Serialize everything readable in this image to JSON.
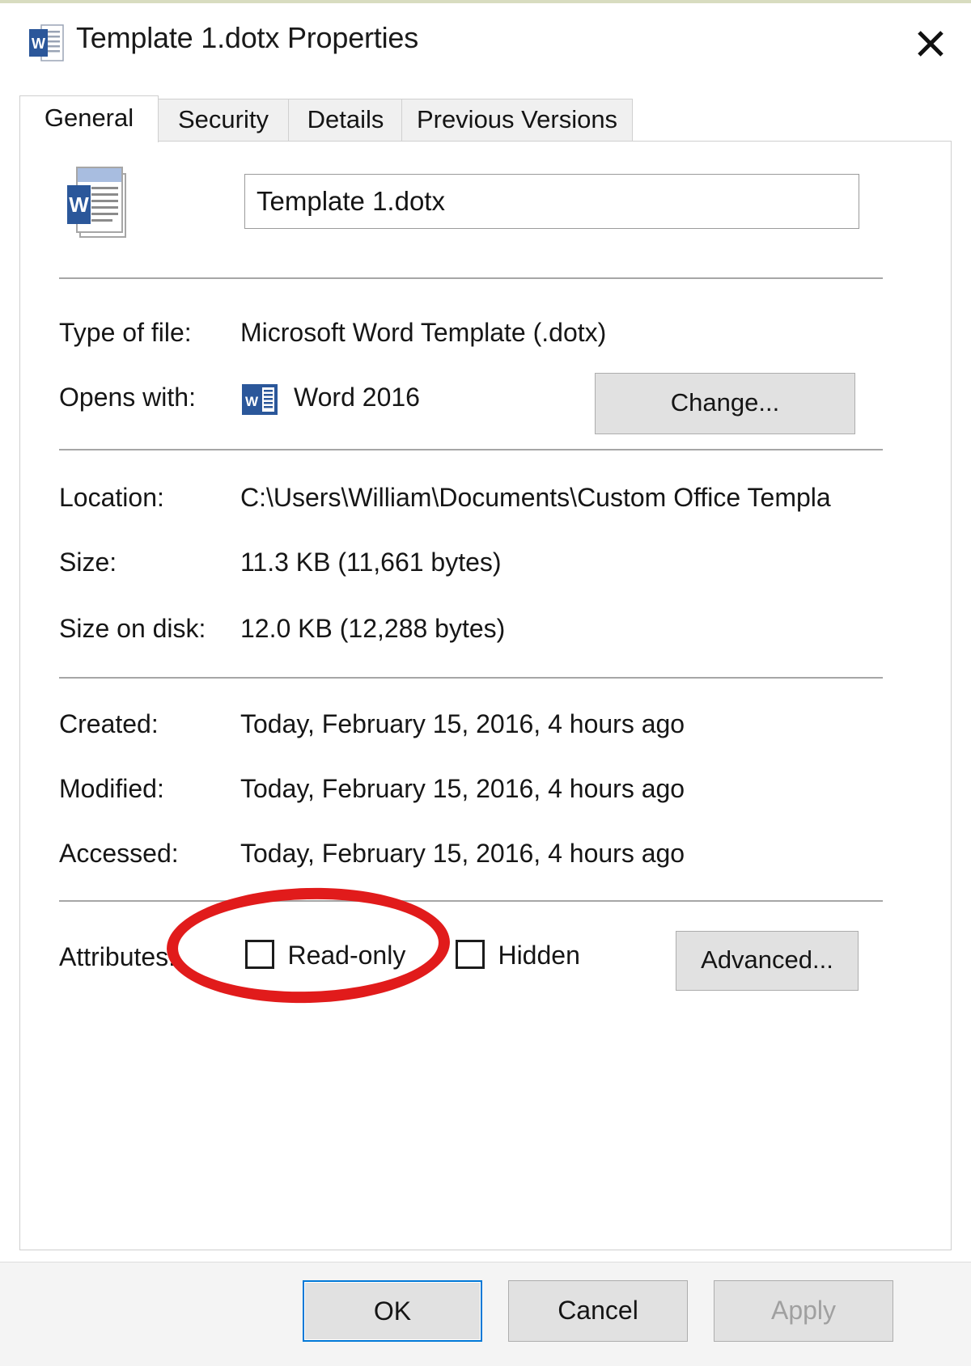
{
  "window": {
    "title": "Template 1.dotx Properties",
    "icon": "word-template-icon",
    "close_label": "✕"
  },
  "tabs": [
    {
      "label": "General",
      "active": true
    },
    {
      "label": "Security",
      "active": false
    },
    {
      "label": "Details",
      "active": false
    },
    {
      "label": "Previous Versions",
      "active": false
    }
  ],
  "general": {
    "file_icon": "word-document-icon",
    "filename_value": "Template 1.dotx",
    "rows": [
      {
        "label": "Type of file:",
        "value": "Microsoft Word Template (.dotx)"
      },
      {
        "label": "Opens with:",
        "value": "Word 2016"
      },
      {
        "label": "Location:",
        "value": "C:\\Users\\William\\Documents\\Custom Office Templa"
      },
      {
        "label": "Size:",
        "value": "11.3 KB (11,661 bytes)"
      },
      {
        "label": "Size on disk:",
        "value": "12.0 KB (12,288 bytes)"
      },
      {
        "label": "Created:",
        "value": "Today, February 15, 2016, 4 hours ago"
      },
      {
        "label": "Modified:",
        "value": "Today, February 15, 2016, 4 hours ago"
      },
      {
        "label": "Accessed:",
        "value": "Today, February 15, 2016, 4 hours ago"
      }
    ],
    "change_button": "Change...",
    "attributes_label": "Attributes:",
    "checkboxes": [
      {
        "label": "Read-only",
        "checked": false
      },
      {
        "label": "Hidden",
        "checked": false
      }
    ],
    "advanced_button": "Advanced..."
  },
  "footer": {
    "ok": "OK",
    "cancel": "Cancel",
    "apply": "Apply",
    "apply_disabled": true
  },
  "annotation": {
    "shape": "red-ellipse-highlight",
    "target": "Read-only",
    "color": "#e11b1b"
  }
}
